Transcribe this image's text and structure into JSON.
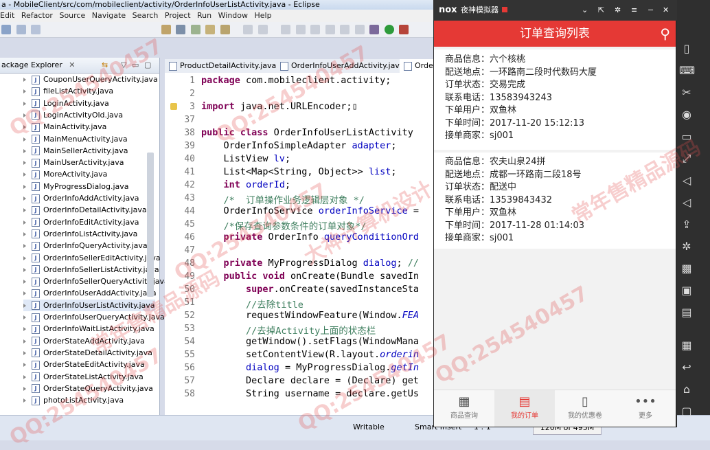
{
  "eclipse": {
    "title": "a - MobileClient/src/com/mobileclient/activity/OrderInfoUserListActivity.java - Eclipse",
    "menu": [
      "Edit",
      "Refactor",
      "Source",
      "Navigate",
      "Search",
      "Project",
      "Run",
      "Window",
      "Help"
    ],
    "package_explorer_title": "ackage Explorer",
    "files": [
      "CouponUserQueryActivity.java",
      "fileListActivity.java",
      "LoginActivity.java",
      "LoginActivityOld.java",
      "MainActivity.java",
      "MainMenuActivity.java",
      "MainSellerActivity.java",
      "MainUserActivity.java",
      "MoreActivity.java",
      "MyProgressDialog.java",
      "OrderInfoAddActivity.java",
      "OrderInfoDetailActivity.java",
      "OrderInfoEditActivity.java",
      "OrderInfoListActivity.java",
      "OrderInfoQueryActivity.java",
      "OrderInfoSellerEditActivity.java",
      "OrderInfoSellerListActivity.java",
      "OrderInfoSellerQueryActivity.java",
      "OrderInfoUserAddActivity.java",
      "OrderInfoUserListActivity.java",
      "OrderInfoUserQueryActivity.java",
      "OrderInfoWaitListActivity.java",
      "OrderStateAddActivity.java",
      "OrderStateDetailActivity.java",
      "OrderStateEditActivity.java",
      "OrderStateListActivity.java",
      "OrderStateQueryActivity.java",
      "photoListActivity.java"
    ],
    "tabs": [
      "ProductDetailActivity.java",
      "OrderInfoUserAddActivity.java",
      "Order"
    ],
    "line_numbers": [
      "1",
      "2",
      "3",
      "37",
      "38",
      "39",
      "40",
      "41",
      "42",
      "43",
      "44",
      "45",
      "46",
      "47",
      "48",
      "49",
      "50",
      "51",
      "52",
      "53",
      "54",
      "55",
      "56",
      "57",
      "58"
    ],
    "status": {
      "writable": "Writable",
      "insert": "Smart Insert",
      "position": "1 : 1",
      "memory": "120M of 495M"
    }
  },
  "emulator": {
    "brand": "nox",
    "app_name": "夜神模拟器",
    "page_title": "订单查询列表",
    "orders": [
      {
        "rows": [
          "商品信息：六个核桃",
          "配送地点：一环路南二段时代数码大厦",
          "订单状态：交易完成",
          "联系电话：13583943243",
          "下单用户：双鱼林",
          "下单时间：2017-11-20 15:12:13",
          "接单商家：sj001"
        ]
      },
      {
        "rows": [
          "商品信息：农夫山泉24拼",
          "配送地点：成都一环路南二段18号",
          "订单状态：配送中",
          "联系电话：13539843432",
          "下单用户：双鱼林",
          "下单时间：2017-11-28 01:14:03",
          "接单商家：sj001"
        ]
      }
    ],
    "nav": [
      {
        "label": "商品查询",
        "icon": "film-icon"
      },
      {
        "label": "我的订单",
        "icon": "order-icon"
      },
      {
        "label": "我的优惠卷",
        "icon": "coupon-icon"
      },
      {
        "label": "更多",
        "icon": "more-icon"
      }
    ],
    "active_color": "#e53935"
  },
  "watermarks": [
    "QQ:254540457",
    "常年售精品源码",
    "大神计算机设计"
  ]
}
